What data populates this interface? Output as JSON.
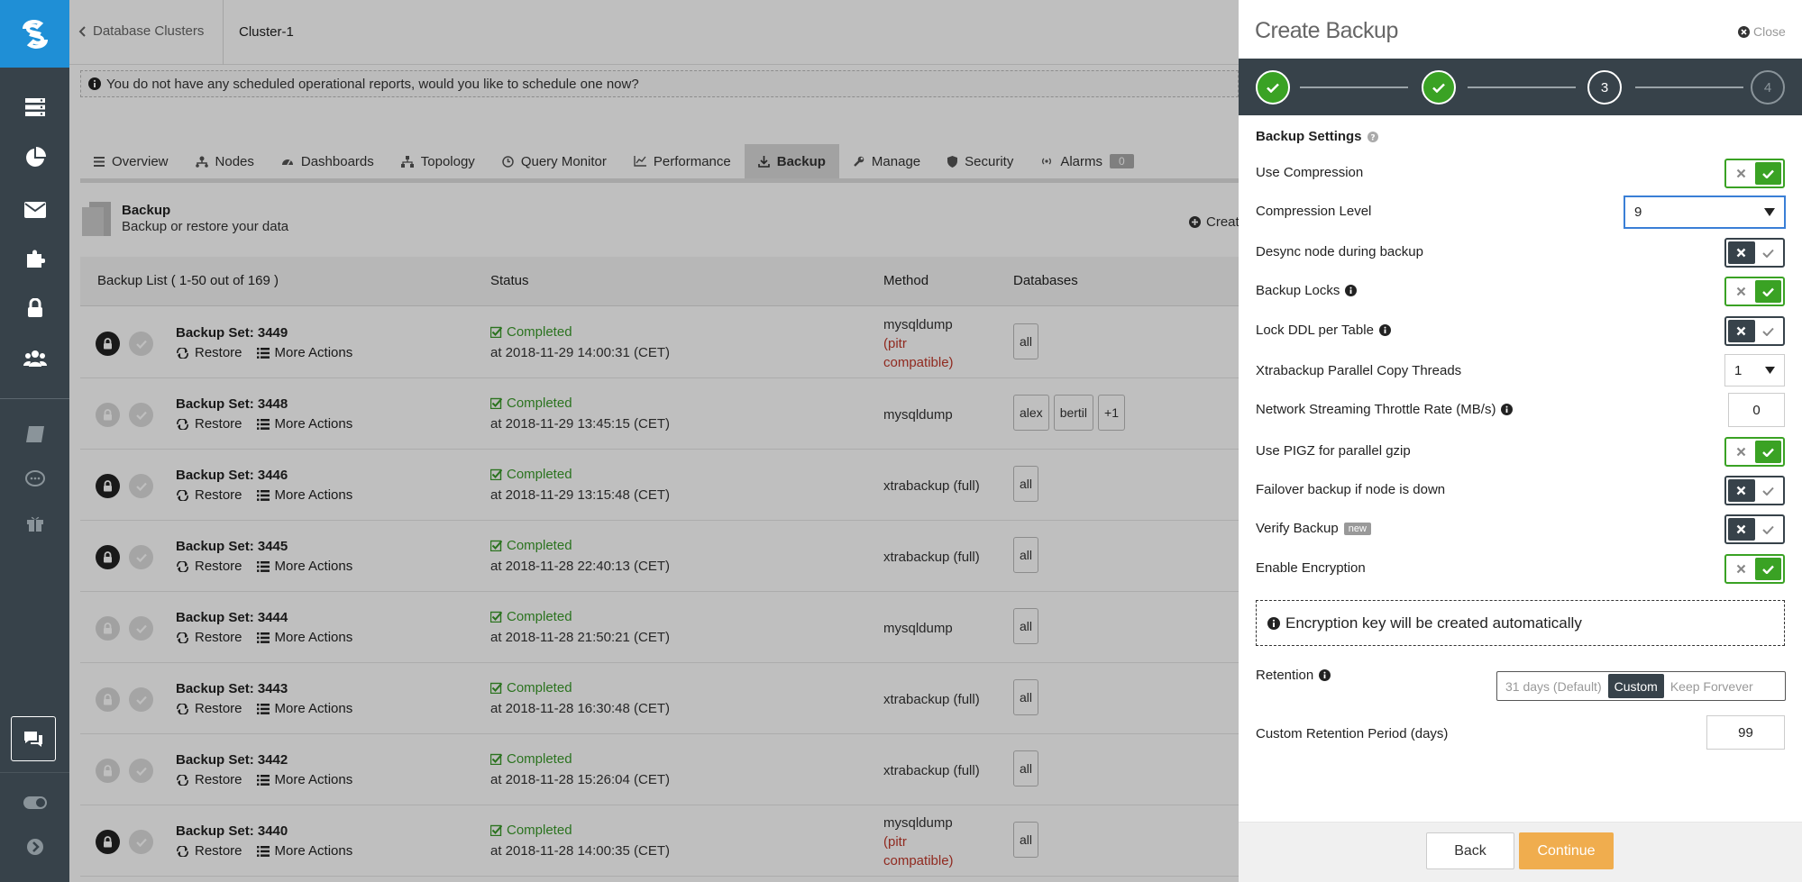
{
  "sidebar": {
    "icons": [
      "servers-icon",
      "chart-pie-icon",
      "mail-icon",
      "puzzle-icon",
      "lock-icon",
      "users-icon",
      "book-icon",
      "chat-bubble-icon",
      "gift-icon",
      "chat-icon",
      "toggle-icon",
      "chevron-right-icon"
    ]
  },
  "header": {
    "back_label": "Database Clusters",
    "current": "Cluster-1"
  },
  "notice": "You do not have any scheduled operational reports, would you like to schedule one now?",
  "tabs": [
    {
      "label": "Overview",
      "icon": "list-icon"
    },
    {
      "label": "Nodes",
      "icon": "nodes-icon"
    },
    {
      "label": "Dashboards",
      "icon": "dashboard-icon"
    },
    {
      "label": "Topology",
      "icon": "topology-icon"
    },
    {
      "label": "Query Monitor",
      "icon": "clock-icon"
    },
    {
      "label": "Performance",
      "icon": "line-chart-icon"
    },
    {
      "label": "Backup",
      "icon": "download-icon"
    },
    {
      "label": "Manage",
      "icon": "wrench-icon"
    },
    {
      "label": "Security",
      "icon": "shield-icon"
    },
    {
      "label": "Alarms",
      "icon": "broadcast-icon",
      "count": "0"
    }
  ],
  "page": {
    "title": "Backup",
    "subtitle": "Backup or restore your data",
    "create_label": "Creat"
  },
  "table": {
    "columns": [
      "Backup List ( 1-50 out of 169 )",
      "Status",
      "Method",
      "Databases"
    ],
    "restore_label": "Restore",
    "more_label": "More Actions",
    "rows": [
      {
        "name": "Backup Set: 3449",
        "locked": true,
        "status": "Completed",
        "at": "at 2018-11-29 14:00:31 (CET)",
        "method": "mysqldump",
        "pitr": "(pitr compatible)",
        "dbs": [
          "all"
        ]
      },
      {
        "name": "Backup Set: 3448",
        "locked": false,
        "status": "Completed",
        "at": "at 2018-11-29 13:45:15 (CET)",
        "method": "mysqldump",
        "pitr": "",
        "dbs": [
          "alex",
          "bertil",
          "+1"
        ]
      },
      {
        "name": "Backup Set: 3446",
        "locked": true,
        "status": "Completed",
        "at": "at 2018-11-29 13:15:48 (CET)",
        "method": "xtrabackup (full)",
        "pitr": "",
        "dbs": [
          "all"
        ]
      },
      {
        "name": "Backup Set: 3445",
        "locked": true,
        "status": "Completed",
        "at": "at 2018-11-28 22:40:13 (CET)",
        "method": "xtrabackup (full)",
        "pitr": "",
        "dbs": [
          "all"
        ]
      },
      {
        "name": "Backup Set: 3444",
        "locked": false,
        "status": "Completed",
        "at": "at 2018-11-28 21:50:21 (CET)",
        "method": "mysqldump",
        "pitr": "",
        "dbs": [
          "all"
        ]
      },
      {
        "name": "Backup Set: 3443",
        "locked": false,
        "status": "Completed",
        "at": "at 2018-11-28 16:30:48 (CET)",
        "method": "xtrabackup (full)",
        "pitr": "",
        "dbs": [
          "all"
        ]
      },
      {
        "name": "Backup Set: 3442",
        "locked": false,
        "status": "Completed",
        "at": "at 2018-11-28 15:26:04 (CET)",
        "method": "xtrabackup (full)",
        "pitr": "",
        "dbs": [
          "all"
        ]
      },
      {
        "name": "Backup Set: 3440",
        "locked": true,
        "status": "Completed",
        "at": "at 2018-11-28 14:00:35 (CET)",
        "method": "mysqldump",
        "pitr": "(pitr compatible)",
        "dbs": [
          "all"
        ]
      }
    ]
  },
  "panel": {
    "title": "Create Backup",
    "close_label": "Close",
    "steps": [
      {
        "label": "",
        "state": "done"
      },
      {
        "label": "",
        "state": "done"
      },
      {
        "label": "3",
        "state": "current"
      },
      {
        "label": "4",
        "state": "todo"
      }
    ],
    "section_title": "Backup Settings",
    "fields": {
      "use_compression": {
        "label": "Use Compression",
        "on": true
      },
      "compression_level": {
        "label": "Compression Level",
        "value": "9"
      },
      "desync": {
        "label": "Desync node during backup",
        "on": false
      },
      "backup_locks": {
        "label": "Backup Locks",
        "on": true
      },
      "lock_ddl": {
        "label": "Lock DDL per Table",
        "on": false
      },
      "copy_threads": {
        "label": "Xtrabackup Parallel Copy Threads",
        "value": "1"
      },
      "throttle": {
        "label": "Network Streaming Throttle Rate (MB/s)",
        "value": "0"
      },
      "pigz": {
        "label": "Use PIGZ for parallel gzip",
        "on": true
      },
      "failover": {
        "label": "Failover backup if node is down",
        "on": false
      },
      "verify": {
        "label": "Verify Backup",
        "badge": "new",
        "on": false
      },
      "encryption": {
        "label": "Enable Encryption",
        "on": true
      }
    },
    "encryption_note": "Encryption key will be created automatically",
    "retention": {
      "label": "Retention",
      "options": [
        "31 days (Default)",
        "Custom",
        "Keep Forvever"
      ],
      "selected": "Custom"
    },
    "custom_retention": {
      "label": "Custom Retention Period (days)",
      "value": "99"
    },
    "back_label": "Back",
    "continue_label": "Continue"
  },
  "colors": {
    "sidebar": "#37424a",
    "logo": "#1f8fd6",
    "success": "#3aa224",
    "continue": "#f0ad4e",
    "pitr": "#c0392b"
  }
}
